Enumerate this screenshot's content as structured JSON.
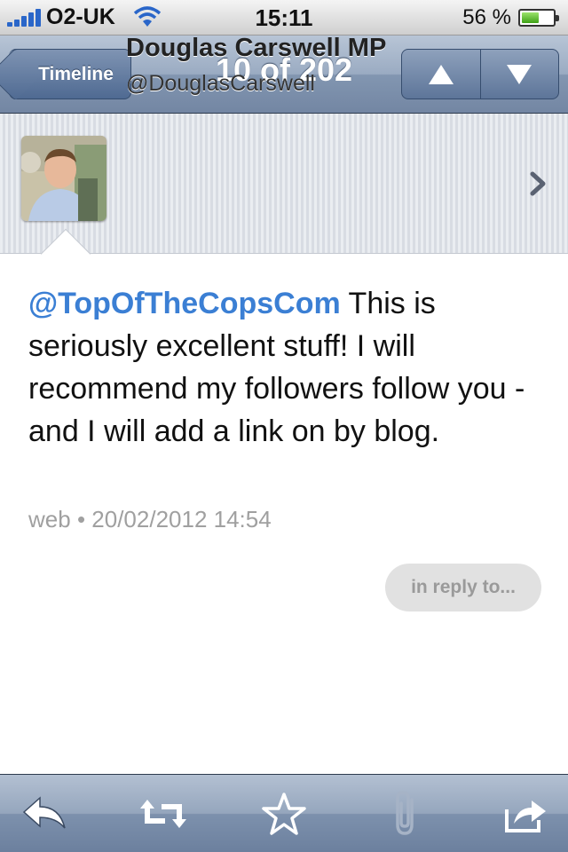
{
  "status_bar": {
    "carrier": "O2-UK",
    "time": "15:11",
    "battery_percent": "56 %",
    "battery_level": 0.56
  },
  "nav": {
    "back_label": "Timeline",
    "title": "10 of 202"
  },
  "user": {
    "display_name": "Douglas Carswell MP",
    "handle": "@DouglasCarswell"
  },
  "tweet": {
    "mention": "@TopOfTheCopsCom",
    "text": " This is seriously excellent stuff! I will recommend my followers follow you - and I will add a link on by blog.",
    "source": "web",
    "separator": "•",
    "timestamp": "20/02/2012 14:54",
    "reply_label": "in reply to..."
  },
  "toolbar": {
    "icons": [
      "reply-icon",
      "retweet-icon",
      "star-icon",
      "paperclip-icon",
      "share-icon"
    ]
  }
}
